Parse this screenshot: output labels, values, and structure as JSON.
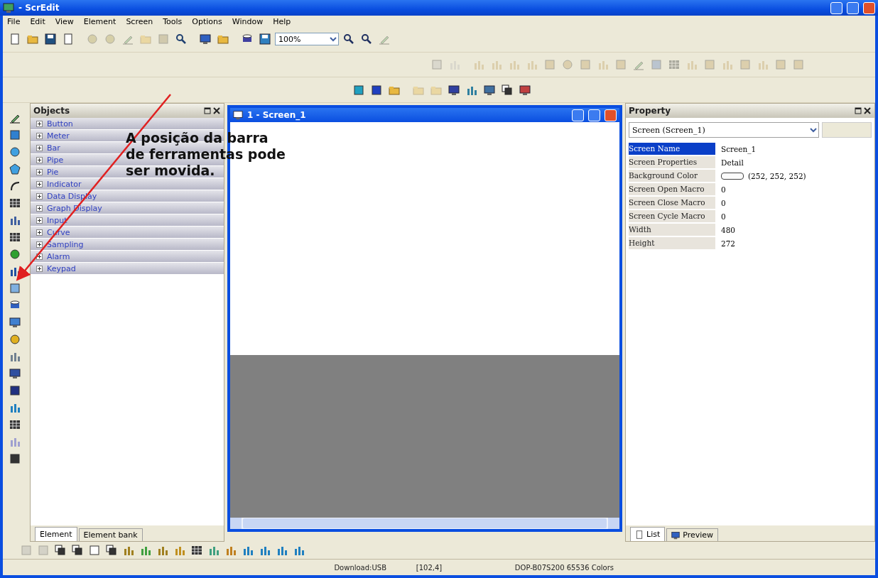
{
  "window": {
    "title": "- ScrEdit"
  },
  "menu": [
    "File",
    "Edit",
    "View",
    "Element",
    "Screen",
    "Tools",
    "Options",
    "Window",
    "Help"
  ],
  "zoom_field": {
    "value": "100%"
  },
  "objects_panel": {
    "title": "Objects",
    "items": [
      {
        "label": "Button",
        "expanded": false
      },
      {
        "label": "Meter",
        "expanded": false
      },
      {
        "label": "Bar",
        "expanded": false
      },
      {
        "label": "Pipe",
        "expanded": false
      },
      {
        "label": "Pie",
        "expanded": false
      },
      {
        "label": "Indicator",
        "expanded": false
      },
      {
        "label": "Data Display",
        "expanded": false
      },
      {
        "label": "Graph Display",
        "expanded": false
      },
      {
        "label": "Input",
        "expanded": false
      },
      {
        "label": "Curve",
        "expanded": false
      },
      {
        "label": "Sampling",
        "expanded": false
      },
      {
        "label": "Alarm",
        "expanded": false
      },
      {
        "label": "Keypad",
        "expanded": false
      }
    ],
    "tabs": [
      {
        "label": "Element",
        "selected": true
      },
      {
        "label": "Element bank",
        "selected": false
      }
    ]
  },
  "screen_window": {
    "title": "1 - Screen_1"
  },
  "property_panel": {
    "title": "Property",
    "selector": "Screen (Screen_1)",
    "rows": [
      {
        "name": "Screen Name",
        "value": "Screen_1",
        "selected": true
      },
      {
        "name": "Screen Properties",
        "value": "Detail",
        "selected": false
      },
      {
        "name": "Background Color",
        "value": "(252, 252, 252)",
        "selected": false,
        "color": "#fcfcfc"
      },
      {
        "name": "Screen Open Macro",
        "value": "0",
        "selected": false
      },
      {
        "name": "Screen Close Macro",
        "value": "0",
        "selected": false
      },
      {
        "name": "Screen Cycle Macro",
        "value": "0",
        "selected": false
      },
      {
        "name": "Width",
        "value": "480",
        "selected": false
      },
      {
        "name": "Height",
        "value": "272",
        "selected": false
      }
    ],
    "tabs": [
      {
        "label": "List",
        "selected": true
      },
      {
        "label": "Preview",
        "selected": false
      }
    ]
  },
  "status_bar": [
    "Download:USB",
    "[102,4]",
    "DOP-B07S200 65536 Colors"
  ],
  "annotation": {
    "text": "A posição da barra de ferramentas pode ser movida."
  }
}
